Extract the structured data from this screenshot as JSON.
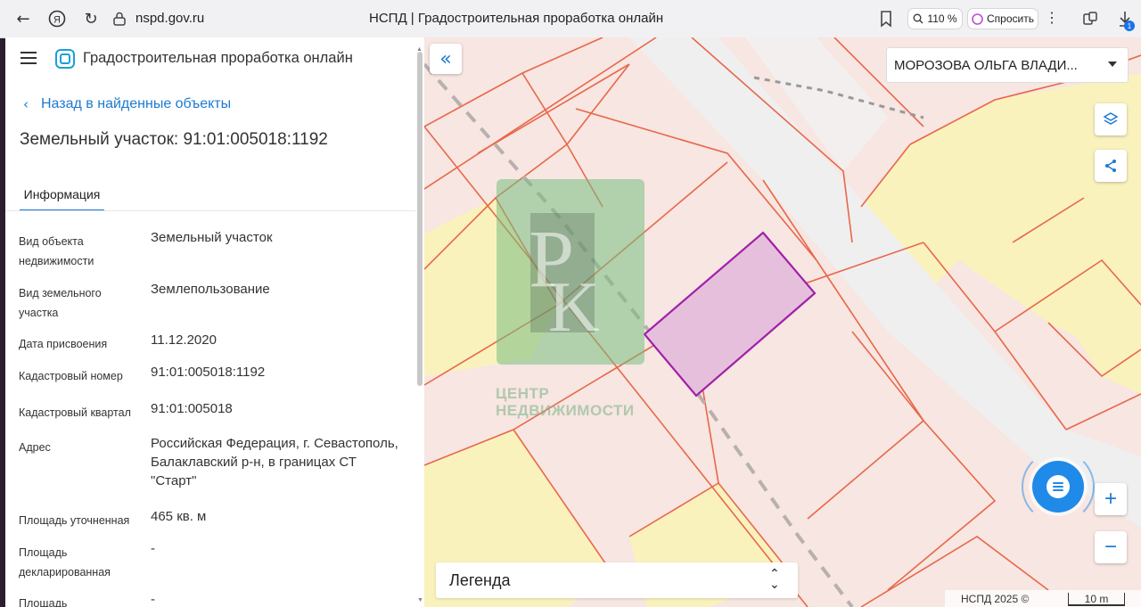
{
  "browser": {
    "url": "nspd.gov.ru",
    "tab_title": "НСПД | Градостроительная проработка онлайн",
    "zoom": "110 %",
    "ask_label": "Спросить",
    "downloads_badge": "1"
  },
  "app": {
    "title": "Градостроительная проработка онлайн",
    "back_link": "Назад в найденные объекты",
    "object_title": "Земельный участок: 91:01:005018:1192",
    "tabs": [
      {
        "label": "Информация",
        "active": true
      }
    ]
  },
  "info_rows": [
    {
      "label": "Вид объекта недвижимости",
      "value": "Земельный участок"
    },
    {
      "label": "Вид земельного участка",
      "value": "Землепользование"
    },
    {
      "label": "Дата присвоения",
      "value": "11.12.2020"
    },
    {
      "label": "Кадастровый номер",
      "value": "91:01:005018:1192"
    },
    {
      "label": "Кадастровый квартал",
      "value": "91:01:005018"
    },
    {
      "label": "Адрес",
      "value": "Российская Федерация, г. Севастополь, Балаклавский р-н, в границах СТ \"Старт\""
    },
    {
      "label": "Площадь уточненная",
      "value": "465 кв. м"
    },
    {
      "label": "Площадь декларированная",
      "value": "-"
    },
    {
      "label": "Площадь",
      "value": "-"
    }
  ],
  "map": {
    "user_selector": "МОРОЗОВА ОЛЬГА ВЛАДИ...",
    "legend_label": "Легенда",
    "copyright": "НСПД 2025 ©",
    "scale": "10 m",
    "watermark_text_1": "ЦЕНТР",
    "watermark_text_2": "НЕДВИЖИМОСТИ",
    "colors": {
      "parcel_fill": "#f7e6e1",
      "parcel_border": "#e8674a",
      "yellow_zone": "#faf2bd",
      "selected_fill": "#e6bfdd",
      "selected_border": "#a020a8",
      "accent": "#1d7ad2"
    }
  }
}
